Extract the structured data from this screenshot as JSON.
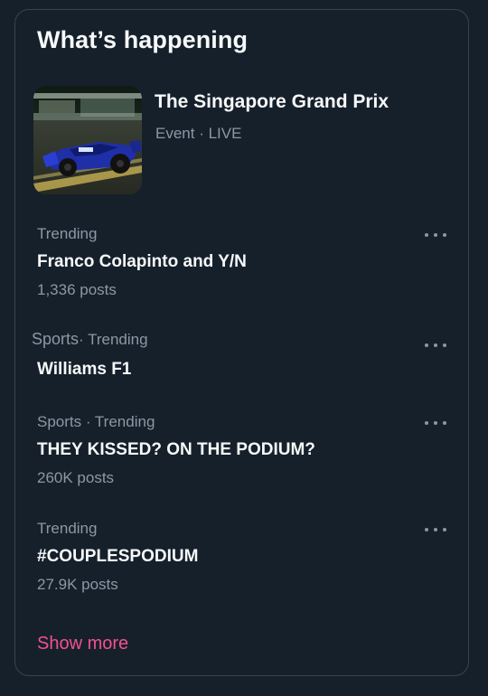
{
  "panel": {
    "title": "What’s happening"
  },
  "event": {
    "title": "The Singapore Grand Prix",
    "meta": "Event · LIVE"
  },
  "trends": [
    {
      "context": "Trending",
      "name": "Franco Colapinto and Y/N",
      "posts": "1,336 posts"
    },
    {
      "context": "Sports",
      "context_suffix": "· Trending",
      "name": "Williams F1",
      "posts": ""
    },
    {
      "context": "Sports · Trending",
      "name": "THEY KISSED? ON THE PODIUM?",
      "posts": "260K posts"
    },
    {
      "context": "Trending",
      "name": "#COUPLESPODIUM",
      "posts": "27.9K posts"
    }
  ],
  "show_more": "Show more",
  "colors": {
    "background": "#15202b",
    "border": "#38444d",
    "text_primary": "#f7f9f9",
    "text_secondary": "#8b98a5",
    "accent": "#f4508f"
  },
  "icons": {
    "more": "more-horizontal-icon"
  }
}
